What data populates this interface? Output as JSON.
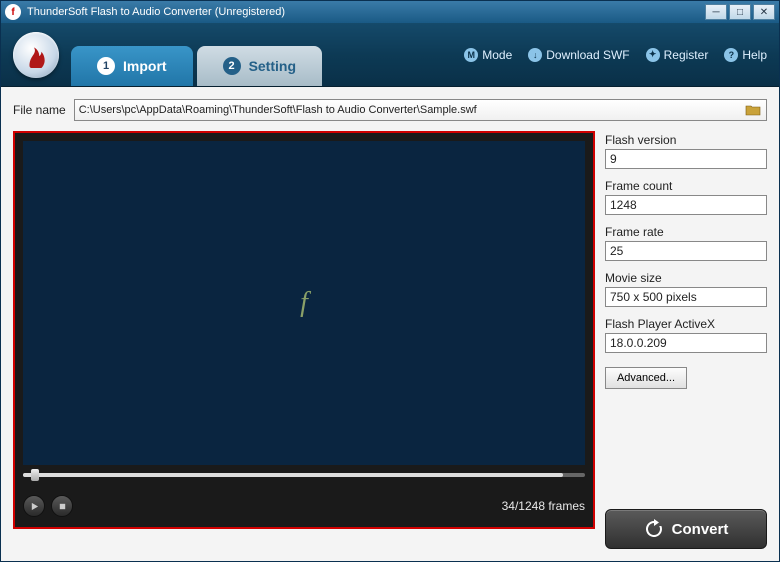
{
  "window": {
    "title": "ThunderSoft Flash to Audio Converter (Unregistered)"
  },
  "toolbar": {
    "mode": "Mode",
    "download": "Download SWF",
    "register": "Register",
    "help": "Help"
  },
  "tabs": {
    "import_num": "1",
    "import_label": "Import",
    "setting_num": "2",
    "setting_label": "Setting"
  },
  "file": {
    "label": "File name",
    "path": "C:\\Users\\pc\\AppData\\Roaming\\ThunderSoft\\Flash to Audio Converter\\Sample.swf"
  },
  "info": {
    "flash_version_label": "Flash version",
    "flash_version": "9",
    "frame_count_label": "Frame count",
    "frame_count": "1248",
    "frame_rate_label": "Frame rate",
    "frame_rate": "25",
    "movie_size_label": "Movie size",
    "movie_size": "750 x 500 pixels",
    "activex_label": "Flash Player ActiveX",
    "activex": "18.0.0.209",
    "advanced": "Advanced..."
  },
  "player": {
    "frame_status": "34/1248 frames"
  },
  "convert": {
    "label": "Convert"
  }
}
